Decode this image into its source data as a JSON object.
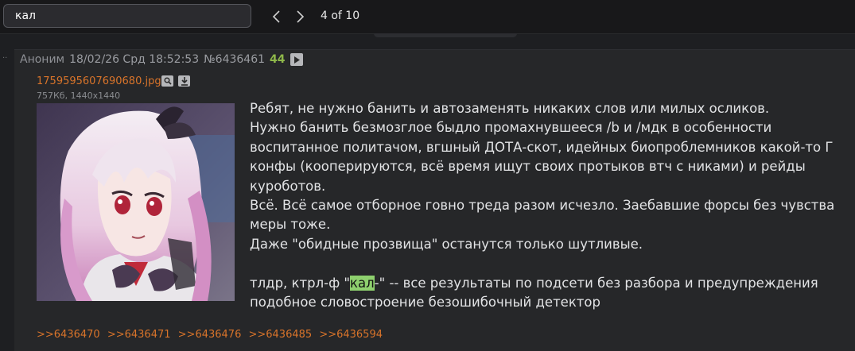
{
  "find_bar": {
    "query": "кал",
    "count_text": "4 of 10"
  },
  "post": {
    "author": "Аноним",
    "date": "18/02/26 Срд 18:52:53",
    "number": "№6436461",
    "reply_count": "44",
    "file": {
      "name": "1759595607690680.jpg",
      "meta": "757Кб, 1440x1440"
    },
    "body": {
      "line1": "Ребят, не нужно банить и автозаменять никаких слов или милых осликов.",
      "line2": "Нужно банить безмозглое быдло промахнувшееся /b и /мдк в особенности",
      "line3": "воспитанное политачом, вгшный ДОТА-скот, идейных биопроблемников какой-то Г",
      "line4": "конфы (кооперируются, всё время ищут своих протыков втч с никами) и рейды",
      "line5": "куроботов.",
      "line6": "Всё. Всё самое отборное говно треда разом исчезло. Заебавшие форсы без чувства",
      "line7": "меры тоже.",
      "line8": "Даже \"обидные прозвища\" останутся только шутливые.",
      "line9_before": "тлдр, ктрл-ф \"",
      "line9_match": "кал",
      "line9_after": "-\" -- все результаты по подсети без разбора и предупреждения",
      "line10": "подобное словостроение безошибочный детектор"
    },
    "replies": [
      ">>6436470",
      ">>6436471",
      ">>6436476",
      ">>6436485",
      ">>6436594"
    ]
  }
}
